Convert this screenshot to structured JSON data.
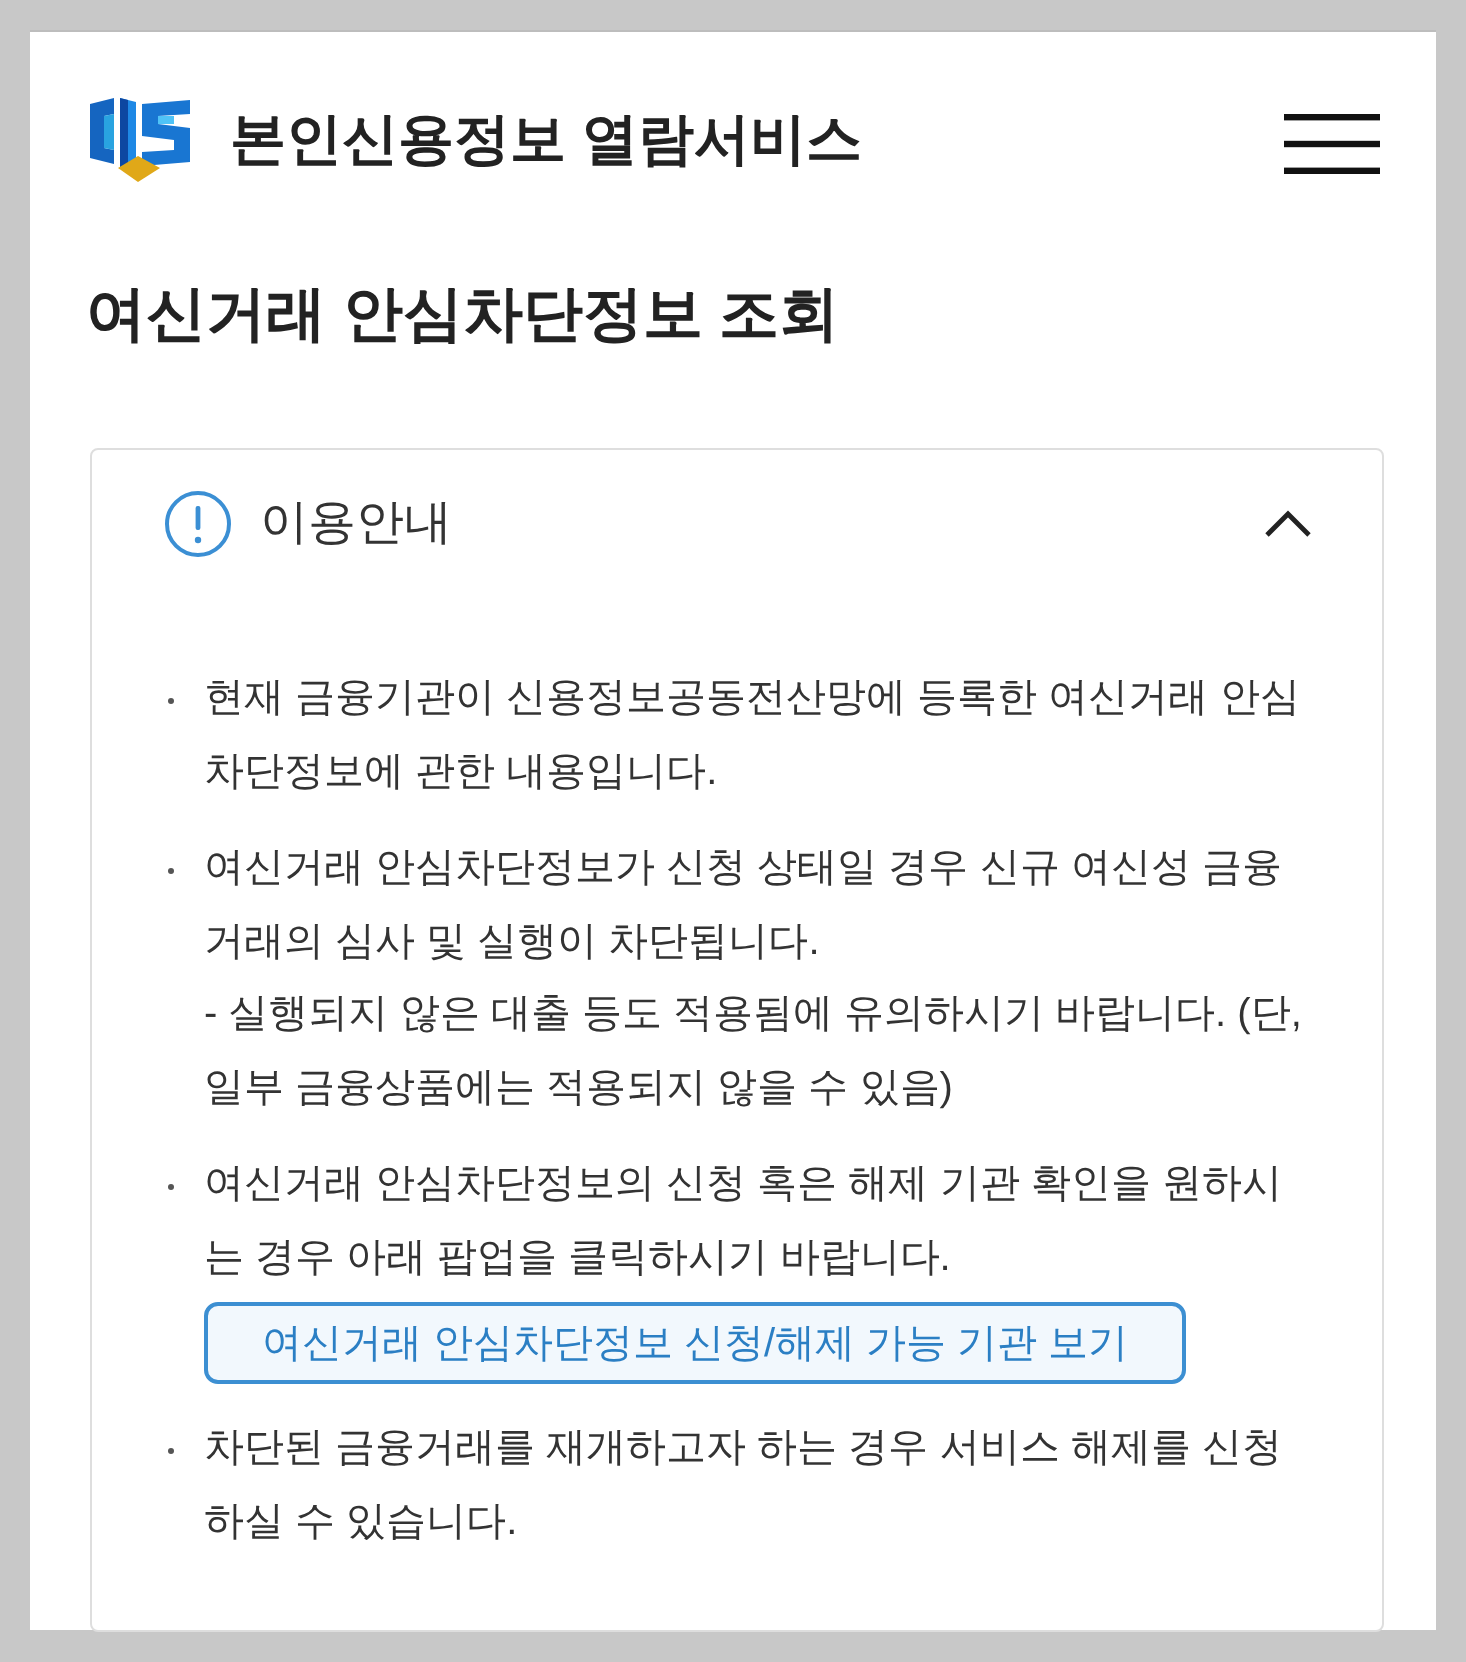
{
  "header": {
    "service_title": "본인신용정보 열람서비스"
  },
  "page_title": "여신거래 안심차단정보 조회",
  "notice_panel": {
    "title": "이용안내",
    "expanded": true,
    "items": [
      {
        "text": "현재 금융기관이 신용정보공동전산망에 등록한 여신거래 안심차단정보에 관한 내용입니다."
      },
      {
        "text": "여신거래 안심차단정보가 신청 상태일 경우 신규 여신성 금융거래의 심사 및 실행이 차단됩니다.",
        "note": "- 실행되지 않은 대출 등도 적용됨에 유의하시기 바랍니다. (단, 일부 금융상품에는 적용되지 않을 수 있음)"
      },
      {
        "text": "여신거래 안심차단정보의 신청 혹은 해제 기관 확인을 원하시는 경우 아래 팝업을 클릭하시기 바랍니다.",
        "button": "여신거래 안심차단정보 신청/해제 가능 기관 보기"
      },
      {
        "text": "차단된 금융거래를 재개하고자 하는 경우 서비스 해제를 신청하실 수 있습니다."
      }
    ]
  }
}
